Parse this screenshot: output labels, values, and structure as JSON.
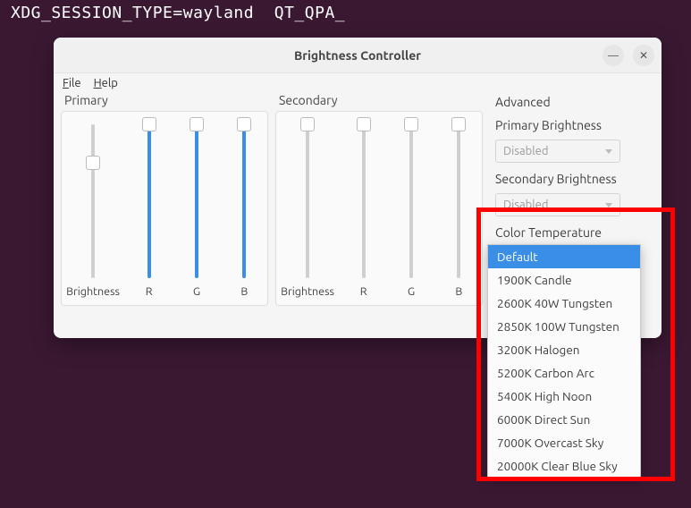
{
  "top_cmd": "XDG_SESSION_TYPE=wayland  QT_QPA_",
  "window": {
    "title": "Brightness Controller",
    "menu": {
      "file": "File",
      "file_mn": "F",
      "help": "Help",
      "help_mn": "H"
    },
    "controls": {
      "minimize": "—",
      "close": "✕"
    }
  },
  "primary": {
    "label": "Primary",
    "sliders": {
      "brightness": {
        "label": "Brightness",
        "value": 75,
        "max": 100
      },
      "r": {
        "label": "R",
        "value": 100,
        "max": 100
      },
      "g": {
        "label": "G",
        "value": 100,
        "max": 100
      },
      "b": {
        "label": "B",
        "value": 100,
        "max": 100
      }
    }
  },
  "secondary": {
    "label": "Secondary",
    "sliders": {
      "brightness": {
        "label": "Brightness",
        "value": 100,
        "max": 100
      },
      "r": {
        "label": "R",
        "value": 100,
        "max": 100
      },
      "g": {
        "label": "G",
        "value": 100,
        "max": 100
      },
      "b": {
        "label": "B",
        "value": 100,
        "max": 100
      }
    }
  },
  "advanced": {
    "label": "Advanced",
    "primary_brightness_label": "Primary Brightness",
    "primary_brightness_value": "Disabled",
    "secondary_brightness_label": "Secondary Brightness",
    "secondary_brightness_value": "Disabled",
    "color_temp_label": "Color Temperature",
    "color_temp_selected": "Default",
    "color_temp_options": [
      "Default",
      "1900K Candle",
      "2600K 40W Tungsten",
      "2850K 100W Tungsten",
      "3200K Halogen",
      "5200K Carbon Arc",
      "5400K High Noon",
      "6000K Direct Sun",
      "7000K Overcast Sky",
      "20000K Clear Blue Sky"
    ]
  }
}
